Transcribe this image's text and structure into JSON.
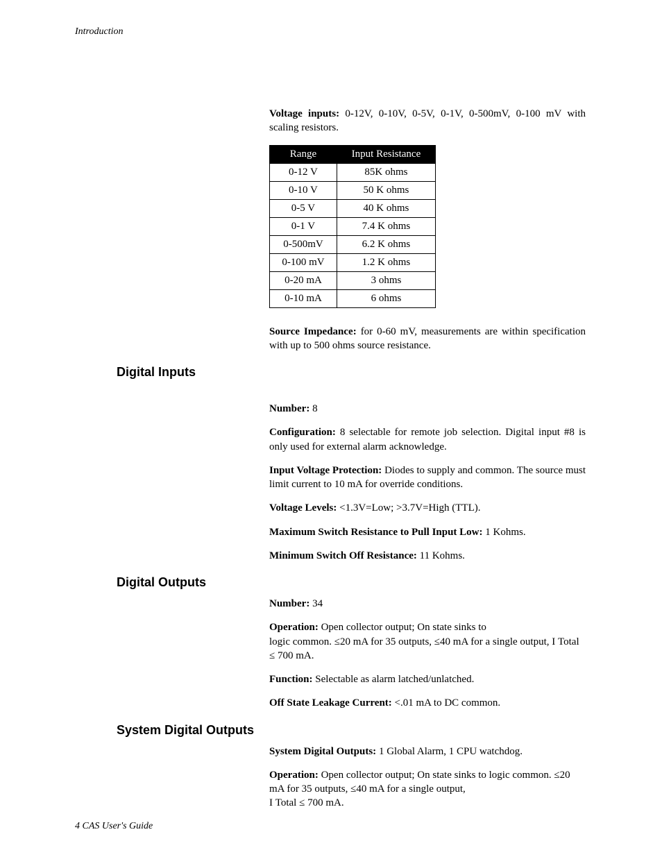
{
  "running_head": "Introduction",
  "footer": "4 CAS User's Guide",
  "voltage_inputs": {
    "label": "Voltage inputs:",
    "text": " 0-12V, 0-10V, 0-5V, 0-1V, 0-500mV, 0-100 mV with scaling resistors."
  },
  "table": {
    "headers": [
      "Range",
      "Input Resistance"
    ],
    "rows": [
      [
        "0-12 V",
        "85K ohms"
      ],
      [
        "0-10 V",
        "50 K ohms"
      ],
      [
        "0-5 V",
        "40 K ohms"
      ],
      [
        "0-1 V",
        "7.4 K ohms"
      ],
      [
        "0-500mV",
        "6.2 K ohms"
      ],
      [
        "0-100 mV",
        "1.2 K ohms"
      ],
      [
        "0-20 mA",
        "3 ohms"
      ],
      [
        "0-10 mA",
        "6 ohms"
      ]
    ]
  },
  "source_impedance": {
    "label": "Source Impedance:",
    "text": " for 0-60 mV, measurements are within specification with up to 500 ohms source resistance."
  },
  "sections": {
    "digital_inputs": {
      "heading": "Digital Inputs",
      "items": [
        {
          "label": "Number:",
          "text": " 8"
        },
        {
          "label": "Configuration:",
          "text": " 8 selectable for remote job selection. Digital input #8 is only used for external alarm acknowledge."
        },
        {
          "label": "Input Voltage Protection:",
          "text": " Diodes to supply and common. The source must limit current to 10 mA for override conditions."
        },
        {
          "label": "Voltage Levels:",
          "text": " <1.3V=Low; >3.7V=High (TTL)."
        },
        {
          "label": "Maximum Switch Resistance to Pull Input Low:",
          "text": " 1 Kohms."
        },
        {
          "label": "Minimum Switch Off Resistance:",
          "text": " 11 Kohms."
        }
      ]
    },
    "digital_outputs": {
      "heading": "Digital Outputs",
      "items": [
        {
          "label": "Number:",
          "text": " 34"
        },
        {
          "label": "Operation:",
          "text": " Open collector output; On state sinks to",
          "text2": "logic common. ≤20 mA for 35 outputs, ≤40 mA for a single output,  Ι Total ≤ 700 mA."
        },
        {
          "label": "Function:",
          "text": " Selectable as alarm latched/unlatched."
        },
        {
          "label": "Off State Leakage Current:",
          "text": " <.01 mA to DC common."
        }
      ]
    },
    "system_digital_outputs": {
      "heading": "System Digital Outputs",
      "items": [
        {
          "label": "System Digital Outputs:",
          "text": " 1 Global Alarm, 1 CPU watchdog."
        },
        {
          "label": "Operation:",
          "text": " Open collector output; On state sinks to logic common. ≤20 mA for 35 outputs, ≤40 mA for a single output,",
          "text2": "Ι Total ≤ 700 mA."
        }
      ]
    }
  }
}
